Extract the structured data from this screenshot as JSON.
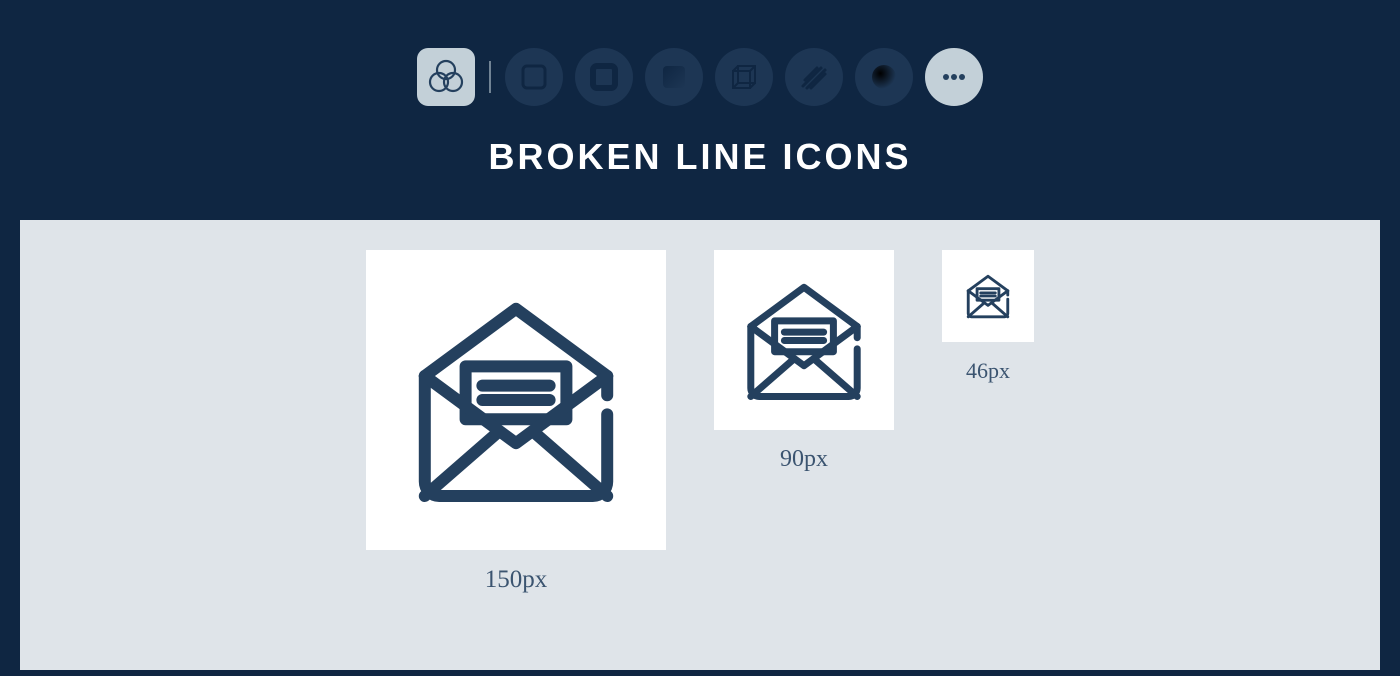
{
  "title": "BROKEN LINE ICONS",
  "toolbar": {
    "items": [
      {
        "name": "venn-icon",
        "active": true
      },
      {
        "name": "square-icon",
        "active": false
      },
      {
        "name": "square-bold-icon",
        "active": false
      },
      {
        "name": "square-fill-icon",
        "active": false
      },
      {
        "name": "cube-icon",
        "active": false
      },
      {
        "name": "scribble-icon",
        "active": false
      },
      {
        "name": "sphere-icon",
        "active": false
      },
      {
        "name": "more-icon",
        "active": false,
        "more": true
      }
    ]
  },
  "previews": {
    "large": {
      "label": "150px",
      "size": 150
    },
    "medium": {
      "label": "90px",
      "size": 90
    },
    "small": {
      "label": "46px",
      "size": 46
    }
  },
  "icon_color": "#24405e"
}
